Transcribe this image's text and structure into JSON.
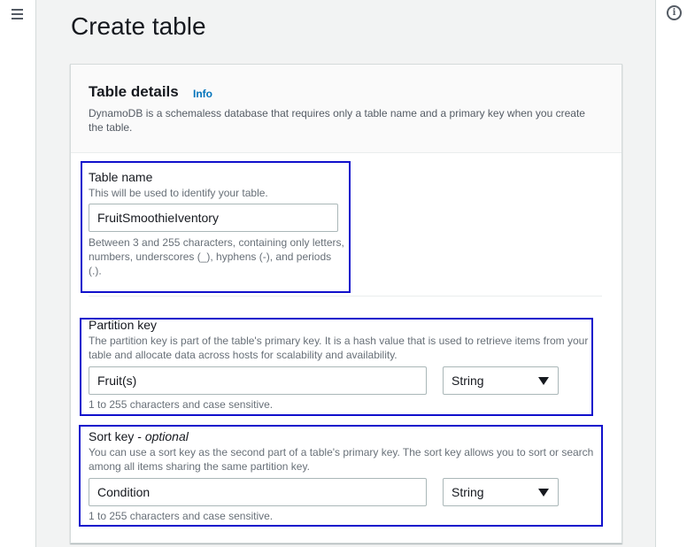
{
  "page": {
    "title": "Create table"
  },
  "navigation": {
    "menu_icon": "hamburger-menu-icon"
  },
  "tools_panel": {
    "icon": "info-circle-icon",
    "glyph": "i"
  },
  "table_details": {
    "title": "Table details",
    "info_link": "Info",
    "description": "DynamoDB is a schemaless database that requires only a table name and a primary key when you create the table."
  },
  "table_name": {
    "label": "Table name",
    "description": "This will be used to identify your table.",
    "value": "FruitSmoothieIventory",
    "constraint": "Between 3 and 255 characters, containing only letters, numbers, underscores (_), hyphens (-), and periods (.)."
  },
  "partition_key": {
    "label": "Partition key",
    "description": "The partition key is part of the table's primary key. It is a hash value that is used to retrieve items from your table and allocate data across hosts for scalability and availability.",
    "value": "Fruit(s)",
    "type": "String",
    "constraint": "1 to 255 characters and case sensitive."
  },
  "sort_key": {
    "label": "Sort key",
    "label_separator": " - ",
    "optional": "optional",
    "description": "You can use a sort key as the second part of a table's primary key. The sort key allows you to sort or search among all items sharing the same partition key.",
    "value": "Condition",
    "type": "String",
    "constraint": "1 to 255 characters and case sensitive."
  },
  "colors": {
    "link": "#0073bb",
    "annotation_box": "#1010cc",
    "page_background": "#f2f3f3",
    "card_background": "#ffffff"
  }
}
